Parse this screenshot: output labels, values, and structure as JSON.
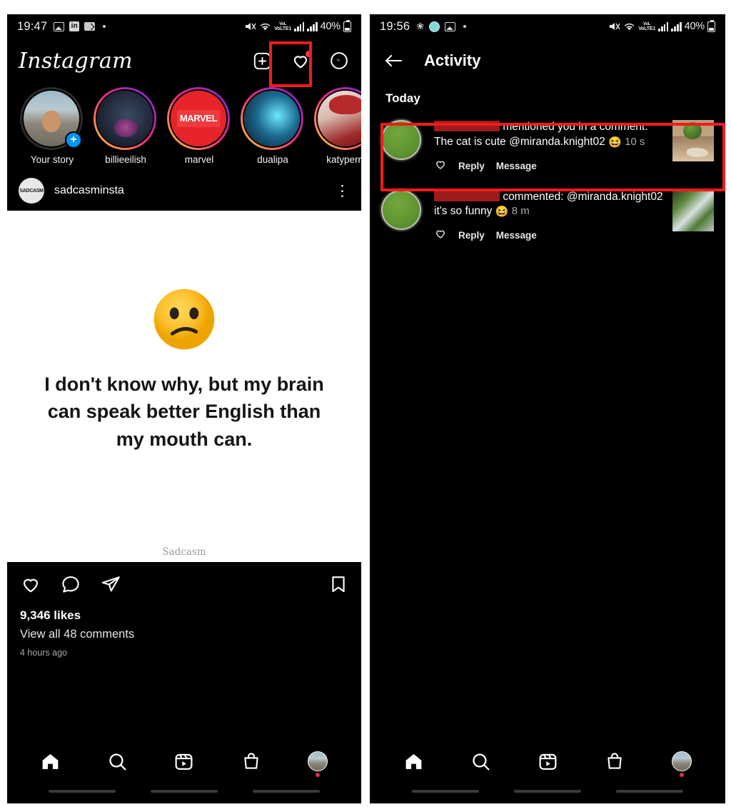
{
  "left_phone": {
    "status_bar": {
      "time": "19:47",
      "icons": [
        "photo-icon",
        "linkedin-icon",
        "app-icon",
        "dot-icon"
      ],
      "network_label": "VoLTE1",
      "battery_text": "40%"
    },
    "header": {
      "logo_text": "Instagram",
      "actions": [
        "add-post-icon",
        "activity-heart-icon",
        "messenger-icon"
      ],
      "activity_badge": true
    },
    "stories": [
      {
        "name": "Your story",
        "has_add_button": true,
        "ring": "none",
        "add_label": "+"
      },
      {
        "name": "billieeilish",
        "has_add_button": false,
        "ring": "gradient"
      },
      {
        "name": "marvel",
        "has_add_button": false,
        "ring": "gradient",
        "logo_text": "MARVEL"
      },
      {
        "name": "dualipa",
        "has_add_button": false,
        "ring": "gradient"
      },
      {
        "name": "katyperry",
        "has_add_button": false,
        "ring": "gradient"
      }
    ],
    "post": {
      "username": "sadcasminsta",
      "avatar_text": "SADCASM",
      "more_icon": "kebab-menu-icon",
      "image": {
        "emoji": "confused-face-emoji",
        "caption_lines": [
          "I don't know why, but my brain",
          "can speak better English than",
          "my mouth can."
        ],
        "watermark": "Sadcasm"
      },
      "actions": [
        "like-icon",
        "comment-icon",
        "share-icon",
        "save-icon"
      ],
      "likes": "9,346 likes",
      "comments_link": "View all 48 comments",
      "timestamp": "4 hours ago"
    },
    "bottom_nav": [
      {
        "icon": "home-icon",
        "active": true
      },
      {
        "icon": "search-icon",
        "active": false
      },
      {
        "icon": "reels-icon",
        "active": false
      },
      {
        "icon": "shop-icon",
        "active": false
      },
      {
        "icon": "profile-avatar-icon",
        "active": false,
        "has_dot": true
      }
    ]
  },
  "right_phone": {
    "status_bar": {
      "time": "19:56",
      "icons": [
        "bluetooth-icon",
        "app-teal-icon",
        "photo-icon",
        "dot-icon"
      ],
      "network_label": "VoLTE1",
      "battery_text": "40%"
    },
    "header": {
      "back_icon": "arrow-left-icon",
      "title": "Activity"
    },
    "section_title": "Today",
    "notifications": [
      {
        "username_redacted": true,
        "text_before": "mentioned you in a comment: The cat is cute",
        "mention": "@miranda.knight02",
        "emoji": "grinning-squinting-face-emoji",
        "time": "10 s",
        "actions": {
          "like_icon": "heart-icon",
          "reply": "Reply",
          "message": "Message"
        },
        "thumbnail": "watermelon-cat-thumbnail",
        "highlighted": true
      },
      {
        "username_redacted": true,
        "text_before": "commented:",
        "mention": "@miranda.knight02",
        "text_after": "it's so funny",
        "emoji": "grinning-squinting-face-emoji",
        "time": "8 m",
        "actions": {
          "like_icon": "heart-icon",
          "reply": "Reply",
          "message": "Message"
        },
        "thumbnail": "garden-thumbnail",
        "highlighted": false
      }
    ],
    "bottom_nav": [
      {
        "icon": "home-icon",
        "active": true
      },
      {
        "icon": "search-icon",
        "active": false
      },
      {
        "icon": "reels-icon",
        "active": false
      },
      {
        "icon": "shop-icon",
        "active": false
      },
      {
        "icon": "profile-avatar-icon",
        "active": false,
        "has_dot": true
      }
    ]
  },
  "annotations": {
    "highlight_color": "#f31a1a",
    "boxes": [
      "activity-heart-icon-highlight",
      "first-notification-highlight"
    ]
  }
}
